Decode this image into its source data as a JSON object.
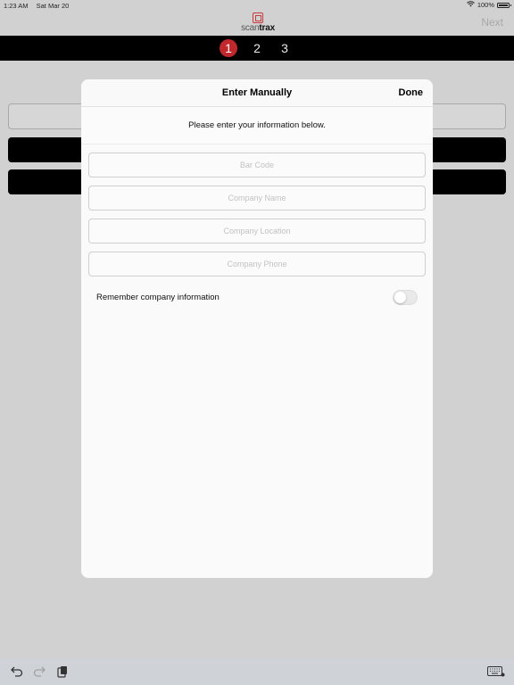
{
  "status_bar": {
    "time": "1:23 AM",
    "date": "Sat Mar 20",
    "battery": "100%"
  },
  "header": {
    "logo_text_light": "scan",
    "logo_text_bold": "trax",
    "next_label": "Next",
    "steps": [
      "1",
      "2",
      "3"
    ],
    "active_step": 1
  },
  "modal": {
    "title": "Enter Manually",
    "done_label": "Done",
    "subtitle": "Please enter your information below.",
    "fields": [
      {
        "placeholder": "Bar Code",
        "value": ""
      },
      {
        "placeholder": "Company Name",
        "value": ""
      },
      {
        "placeholder": "Company Location",
        "value": ""
      },
      {
        "placeholder": "Company Phone",
        "value": ""
      }
    ],
    "remember_label": "Remember company information",
    "remember_on": false
  },
  "toolbar": {
    "icons": [
      "undo-icon",
      "redo-icon",
      "paste-icon",
      "keyboard-icon"
    ]
  }
}
